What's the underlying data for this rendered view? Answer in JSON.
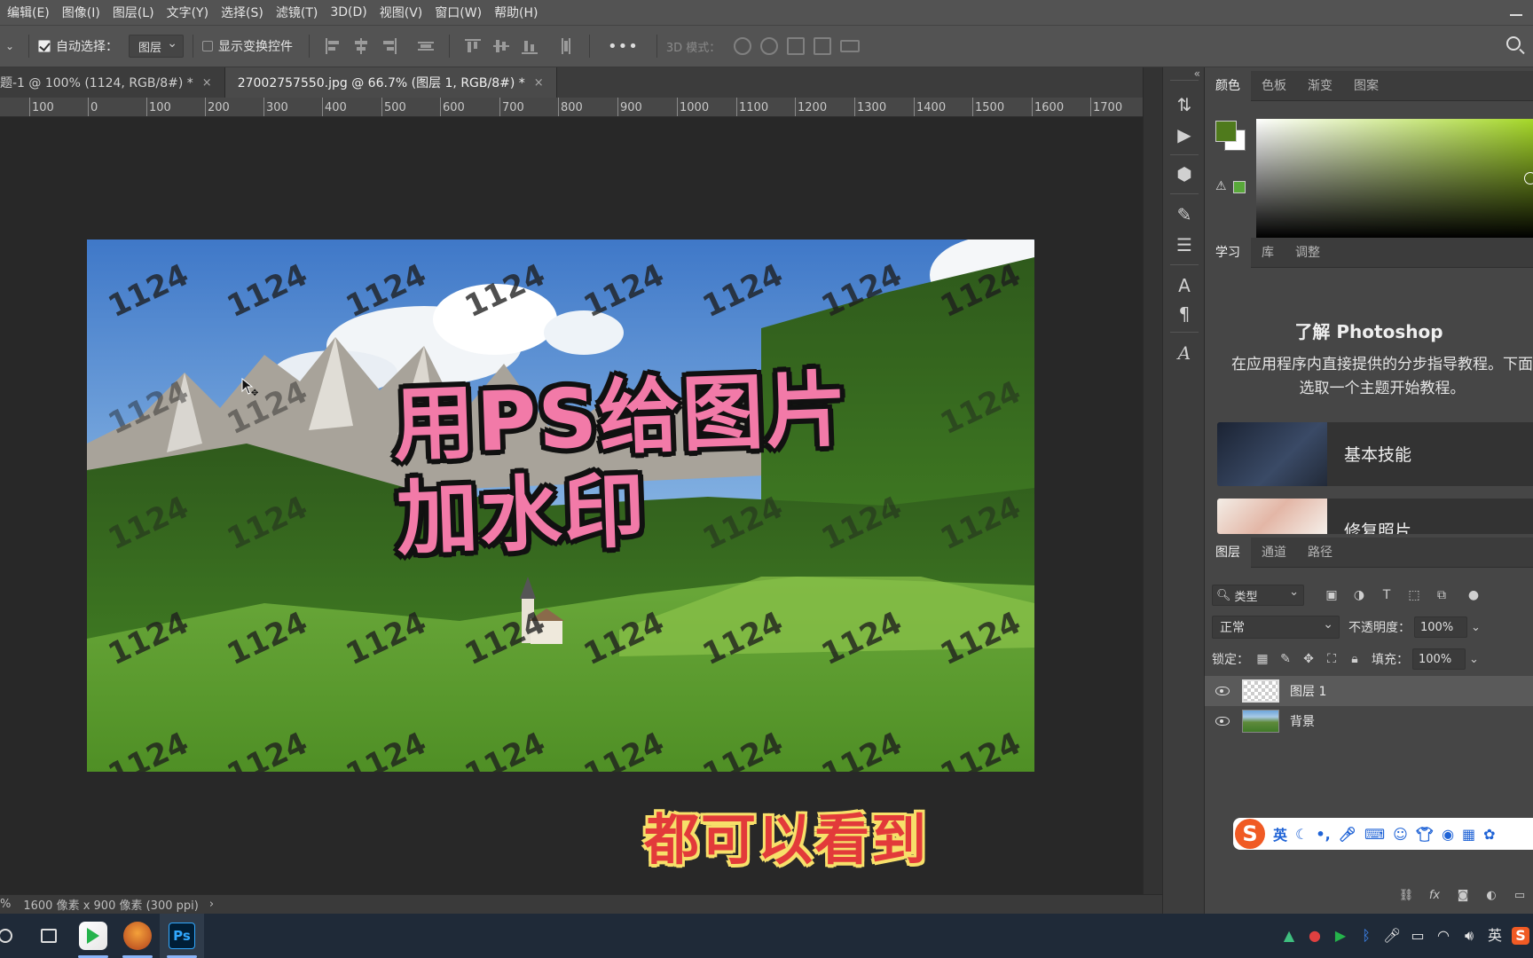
{
  "menubar": {
    "items": [
      "编辑(E)",
      "图像(I)",
      "图层(L)",
      "文字(Y)",
      "选择(S)",
      "滤镜(T)",
      "3D(D)",
      "视图(V)",
      "窗口(W)",
      "帮助(H)"
    ]
  },
  "options": {
    "auto_select_label": "自动选择：",
    "auto_select_value": "图层",
    "show_transform_label": "显示变换控件",
    "more_label": "•••",
    "mode3d_label": "3D 模式："
  },
  "tabs": [
    {
      "label": "题-1 @ 100% (1124, RGB/8#) *",
      "close": "×"
    },
    {
      "label": "27002757550.jpg @ 66.7% (图层 1, RGB/8#) *",
      "close": "×"
    }
  ],
  "ruler": {
    "ticks": [
      "100",
      "0",
      "100",
      "200",
      "300",
      "400",
      "500",
      "600",
      "700",
      "800",
      "900",
      "1000",
      "1100",
      "1200",
      "1300",
      "1400",
      "1500",
      "1600",
      "1700"
    ]
  },
  "canvas": {
    "watermark_text": "1124",
    "headline_line1": "用PS给图片",
    "headline_line2": "加水印",
    "caption": "都可以看到"
  },
  "status": {
    "zoom_prefix": "%",
    "doc_size": "1600 像素 x 900 像素 (300 ppi)",
    "arrow": "›"
  },
  "color_panel": {
    "tabs": [
      "颜色",
      "色板",
      "渐变",
      "图案"
    ],
    "fg_color": "#4f7a1c",
    "bg_color": "#ffffff",
    "gamut_warning": "⚠"
  },
  "learn_panel": {
    "tabs": [
      "学习",
      "库",
      "调整"
    ],
    "title": "了解 Photoshop",
    "description": "在应用程序内直接提供的分步指导教程。下面选取一个主题开始教程。",
    "cards": [
      "基本技能",
      "修复照片"
    ]
  },
  "layers_panel": {
    "tabs": [
      "图层",
      "通道",
      "路径"
    ],
    "filter_label": "类型",
    "blend_mode": "正常",
    "opacity_label": "不透明度：",
    "opacity_value": "100%",
    "lock_label": "锁定：",
    "fill_label": "填充：",
    "fill_value": "100%",
    "layers": [
      {
        "name": "图层 1",
        "selected": true
      },
      {
        "name": "背景",
        "selected": false
      }
    ]
  },
  "ime": {
    "logo": "S",
    "lang": "英"
  },
  "taskbar": {
    "ps_label": "Ps",
    "tray_lang": "英"
  }
}
